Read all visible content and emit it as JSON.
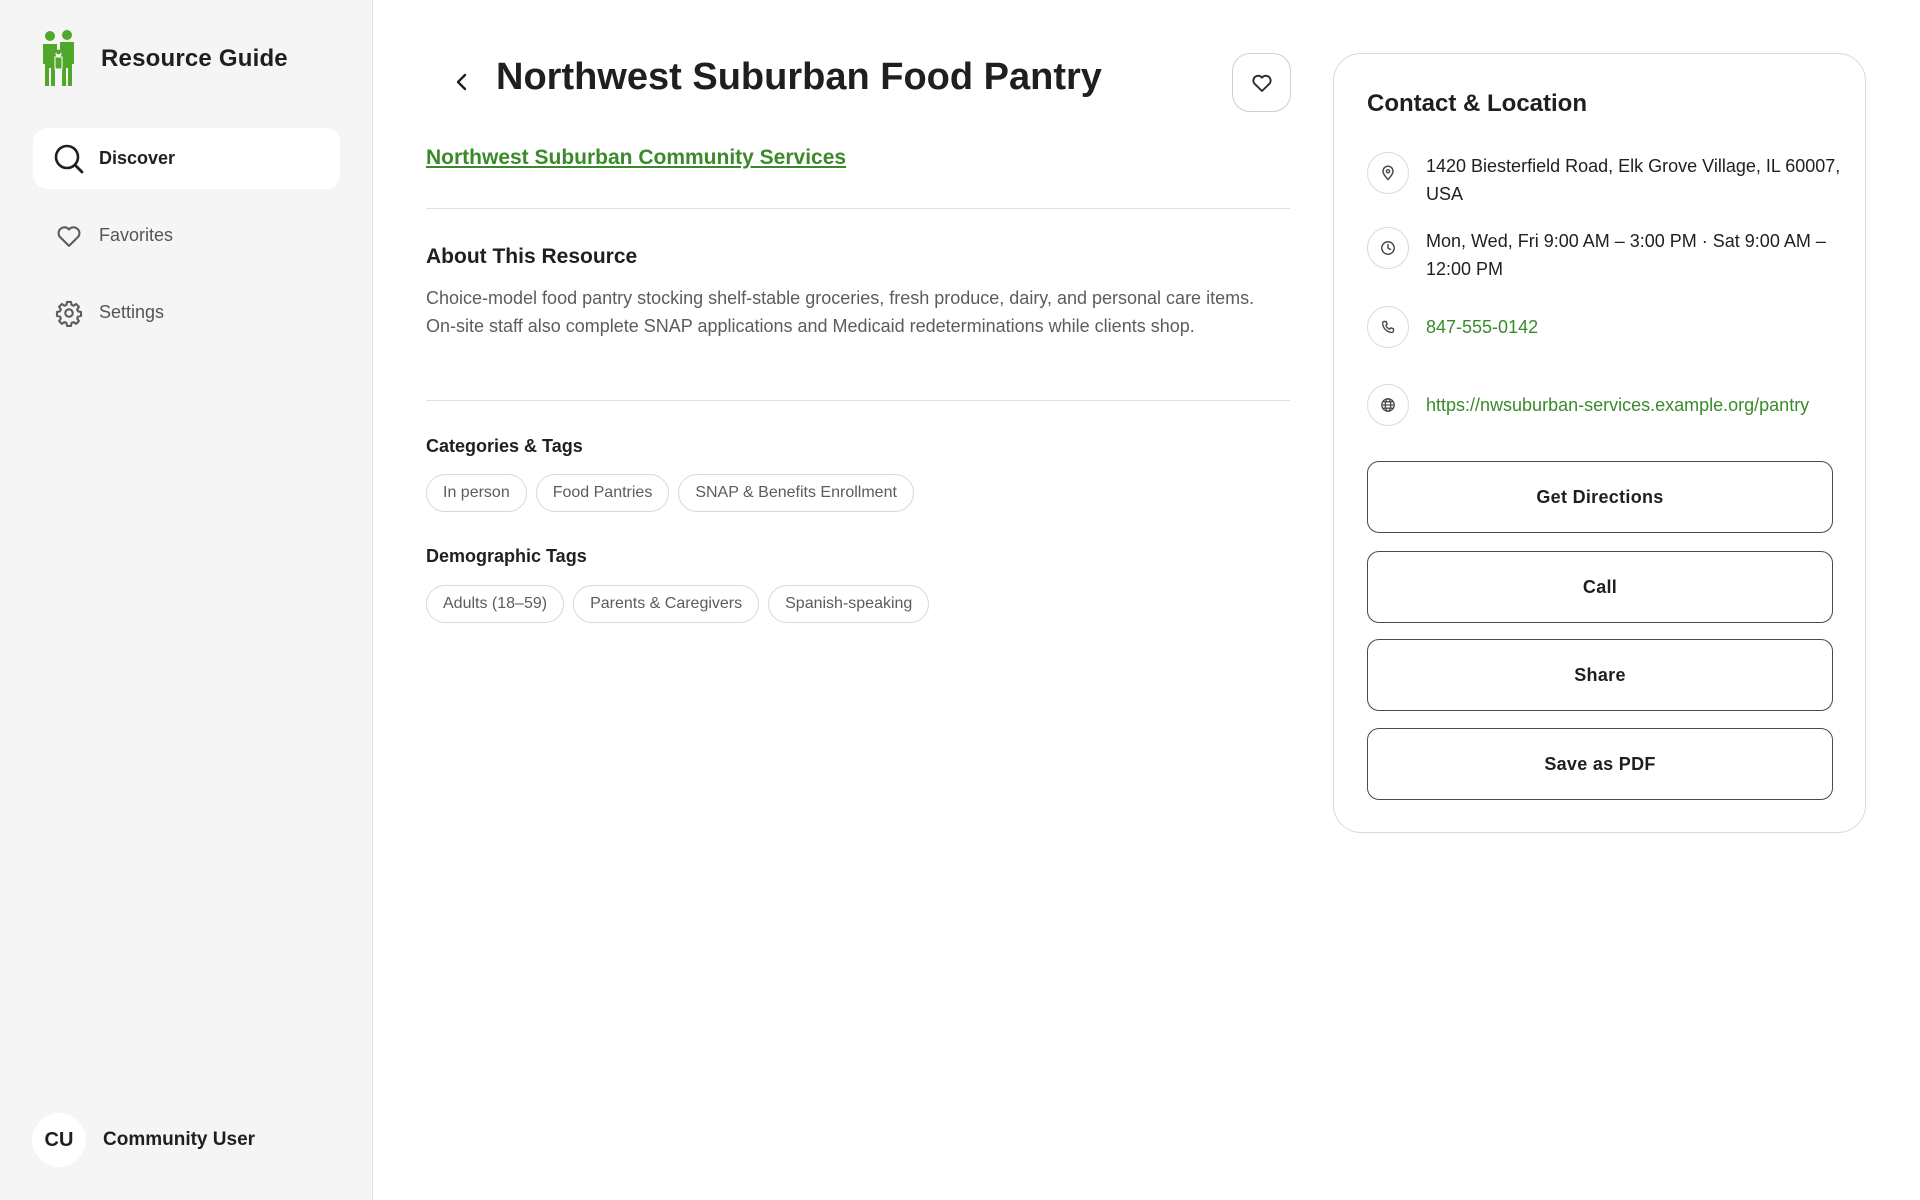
{
  "app": {
    "name": "Resource Guide",
    "accent_color": "#3a8a2b",
    "logo_color": "#4fa82a"
  },
  "sidebar": {
    "items": [
      {
        "label": "Discover",
        "icon": "search-icon",
        "active": true
      },
      {
        "label": "Favorites",
        "icon": "heart-icon",
        "active": false
      },
      {
        "label": "Settings",
        "icon": "gear-icon",
        "active": false
      }
    ]
  },
  "user": {
    "initials": "CU",
    "name": "Community User"
  },
  "resource": {
    "title": "Northwest Suburban Food Pantry",
    "organization": "Northwest Suburban Community Services",
    "about_heading": "About This Resource",
    "about_text": "Choice-model food pantry stocking shelf-stable groceries, fresh produce, dairy, and personal care items. On-site staff also complete SNAP applications and Medicaid redeterminations while clients shop.",
    "categories_heading": "Categories & Tags",
    "categories": [
      "In person",
      "Food Pantries",
      "SNAP & Benefits Enrollment"
    ],
    "demographics_heading": "Demographic Tags",
    "demographics": [
      "Adults (18–59)",
      "Parents & Caregivers",
      "Spanish-speaking"
    ]
  },
  "contact": {
    "heading": "Contact & Location",
    "address": "1420 Biesterfield Road, Elk Grove Village, IL 60007, USA",
    "hours": "Mon, Wed, Fri 9:00 AM – 3:00 PM · Sat 9:00 AM – 12:00 PM",
    "phone": "847-555-0142",
    "website": "https://nwsuburban-services.example.org/pantry",
    "buttons": {
      "directions": "Get Directions",
      "call": "Call",
      "share": "Share",
      "pdf": "Save as PDF"
    }
  }
}
